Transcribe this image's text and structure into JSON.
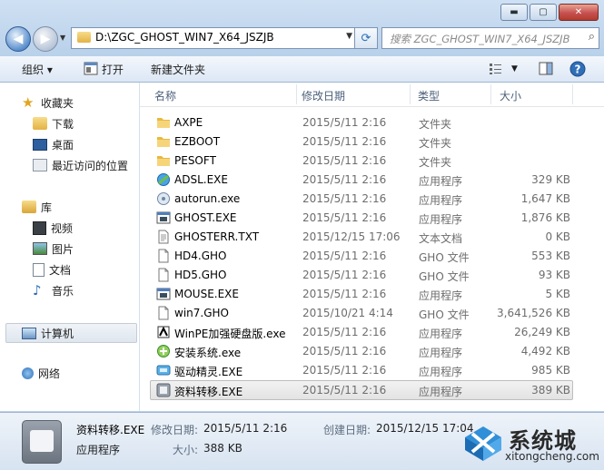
{
  "window": {
    "min_label": "▬",
    "max_label": "▢",
    "close_label": "✕"
  },
  "nav": {
    "address": "D:\\ZGC_GHOST_WIN7_X64_JSZJB",
    "search_placeholder": "搜索 ZGC_GHOST_WIN7_X64_JSZJB"
  },
  "toolbar": {
    "organize": "组织 ▾",
    "open": "打开",
    "new_folder": "新建文件夹"
  },
  "sidebar": {
    "favorites": {
      "label": "收藏夹",
      "items": [
        "下载",
        "桌面",
        "最近访问的位置"
      ]
    },
    "libraries": {
      "label": "库",
      "items": [
        "视频",
        "图片",
        "文档",
        "音乐"
      ]
    },
    "computer": "计算机",
    "network": "网络"
  },
  "columns": {
    "name": "名称",
    "date": "修改日期",
    "type": "类型",
    "size": "大小"
  },
  "files": [
    {
      "name": "AXPE",
      "date": "2015/5/11 2:16",
      "type": "文件夹",
      "size": "",
      "icon": "folder-icon"
    },
    {
      "name": "EZBOOT",
      "date": "2015/5/11 2:16",
      "type": "文件夹",
      "size": "",
      "icon": "folder-icon"
    },
    {
      "name": "PESOFT",
      "date": "2015/5/11 2:16",
      "type": "文件夹",
      "size": "",
      "icon": "folder-icon"
    },
    {
      "name": "ADSL.EXE",
      "date": "2015/5/11 2:16",
      "type": "应用程序",
      "size": "329 KB",
      "icon": "network-exe-icon"
    },
    {
      "name": "autorun.exe",
      "date": "2015/5/11 2:16",
      "type": "应用程序",
      "size": "1,647 KB",
      "icon": "autorun-icon"
    },
    {
      "name": "GHOST.EXE",
      "date": "2015/5/11 2:16",
      "type": "应用程序",
      "size": "1,876 KB",
      "icon": "app-window-icon"
    },
    {
      "name": "GHOSTERR.TXT",
      "date": "2015/12/15 17:06",
      "type": "文本文档",
      "size": "0 KB",
      "icon": "text-file-icon"
    },
    {
      "name": "HD4.GHO",
      "date": "2015/5/11 2:16",
      "type": "GHO 文件",
      "size": "553 KB",
      "icon": "blank-file-icon"
    },
    {
      "name": "HD5.GHO",
      "date": "2015/5/11 2:16",
      "type": "GHO 文件",
      "size": "93 KB",
      "icon": "blank-file-icon"
    },
    {
      "name": "MOUSE.EXE",
      "date": "2015/5/11 2:16",
      "type": "应用程序",
      "size": "5 KB",
      "icon": "app-window-icon"
    },
    {
      "name": "win7.GHO",
      "date": "2015/10/21 4:14",
      "type": "GHO 文件",
      "size": "3,641,526 KB",
      "icon": "blank-file-icon"
    },
    {
      "name": "WinPE加强硬盘版.exe",
      "date": "2015/5/11 2:16",
      "type": "应用程序",
      "size": "26,249 KB",
      "icon": "winpe-icon"
    },
    {
      "name": "安装系统.exe",
      "date": "2015/5/11 2:16",
      "type": "应用程序",
      "size": "4,492 KB",
      "icon": "install-icon"
    },
    {
      "name": "驱动精灵.EXE",
      "date": "2015/5/11 2:16",
      "type": "应用程序",
      "size": "985 KB",
      "icon": "driver-icon"
    },
    {
      "name": "资料转移.EXE",
      "date": "2015/5/11 2:16",
      "type": "应用程序",
      "size": "389 KB",
      "icon": "transfer-icon"
    }
  ],
  "selected_index": 14,
  "details": {
    "name": "资料转移.EXE",
    "type": "应用程序",
    "modified_label": "修改日期:",
    "modified": "2015/5/11 2:16",
    "created_label": "创建日期:",
    "created": "2015/12/15 17:04",
    "size_label": "大小:",
    "size": "388 KB"
  },
  "watermark": {
    "title": "系统城",
    "url": "xitongcheng.com"
  }
}
